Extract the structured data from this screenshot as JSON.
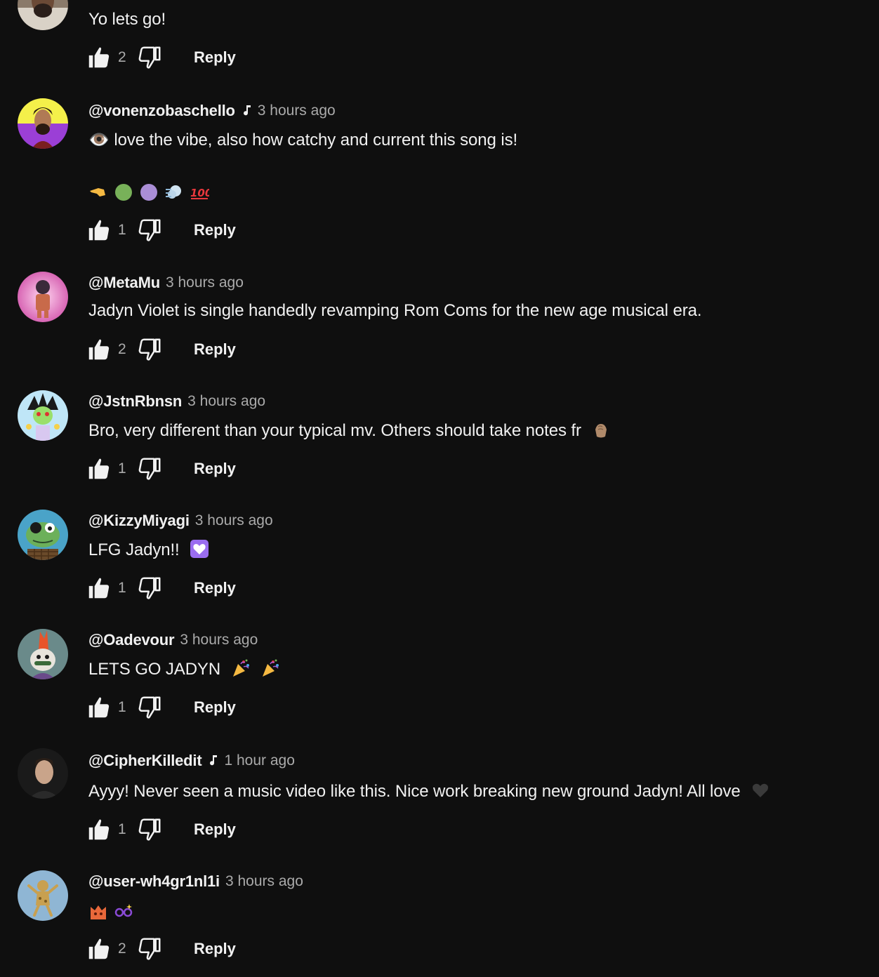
{
  "comments": [
    {
      "author": "",
      "time": "",
      "text": "Yo lets go!",
      "likes": "2",
      "reply_label": "Reply",
      "avatar": "man-beard-avatar"
    },
    {
      "author": "@vonenzobaschello",
      "music_note": true,
      "time": "3 hours ago",
      "text": "👁️ love the vibe, also how catchy and current this song is!",
      "emoji_line": [
        "backhand-index-left",
        "green-circle",
        "purple-circle",
        "dash",
        "hundred-points"
      ],
      "likes": "1",
      "reply_label": "Reply",
      "avatar": "man-beard-yellow-purple-avatar"
    },
    {
      "author": "@MetaMu",
      "time": "3 hours ago",
      "text": "Jadyn Violet is single handedly revamping Rom Coms for the new age musical era.",
      "likes": "2",
      "reply_label": "Reply",
      "avatar": "pink-character-avatar"
    },
    {
      "author": "@JstnRbnsn",
      "time": "3 hours ago",
      "text": "Bro, very different than your typical mv. Others should take notes fr",
      "trailing_emoji": "clapping-hands",
      "likes": "1",
      "reply_label": "Reply",
      "avatar": "anime-character-avatar"
    },
    {
      "author": "@KizzyMiyagi",
      "time": "3 hours ago",
      "text": "LFG Jadyn!!",
      "trailing_emoji": "purple-heart",
      "likes": "1",
      "reply_label": "Reply",
      "avatar": "frog-eyepatch-avatar"
    },
    {
      "author": "@Oadevour",
      "time": "3 hours ago",
      "text": "LETS GO JADYN",
      "trailing_emoji": "party-popper-x2",
      "likes": "1",
      "reply_label": "Reply",
      "avatar": "bird-mohawk-avatar"
    },
    {
      "author": "@CipherKilledit",
      "music_note": true,
      "time": "1 hour ago",
      "text": "Ayyy! Never seen a music video like this. Nice work breaking new ground Jadyn! All love",
      "trailing_emoji": "black-heart",
      "likes": "1",
      "reply_label": "Reply",
      "avatar": "man-portrait-avatar"
    },
    {
      "author": "@user-wh4gr1nl1i",
      "time": "3 hours ago",
      "text": "",
      "emoji_line": [
        "red-cat-face",
        "glasses"
      ],
      "likes": "2",
      "reply_label": "Reply",
      "avatar": "golden-figure-avatar"
    }
  ],
  "colors": {
    "background": "#0f0f0f",
    "text": "#f1f1f1",
    "secondary_text": "#aaaaaa"
  }
}
